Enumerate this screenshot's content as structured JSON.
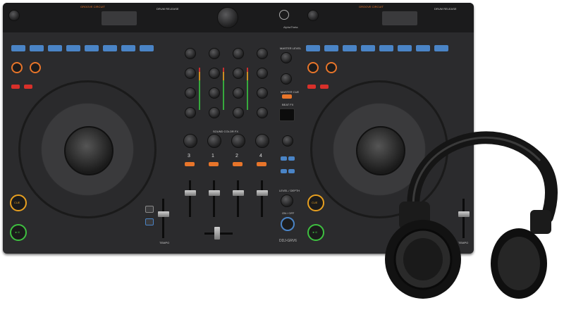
{
  "product": {
    "model": "DDJ-GRV6",
    "brand": "AlphaTheta"
  },
  "deck_labels": {
    "groove_circuit": "GROOVE CIRCUIT",
    "capture": "CAPTURE",
    "drum_release": "DRUM RELEASE",
    "beat_fx": "BEAT FX",
    "sound_color_fx": "SOUND COLOR FX",
    "master_level": "MASTER LEVEL",
    "master_cue": "MASTER CUE",
    "level_depth": "LEVEL / DEPTH",
    "on_off": "ON / OFF",
    "cue": "CUE",
    "play": "►/II",
    "tempo": "TEMPO"
  },
  "channels": [
    "3",
    "1",
    "2",
    "4"
  ],
  "eq_labels": [
    "TRIM",
    "HI",
    "MID",
    "LOW"
  ],
  "colors": {
    "body": "#2b2b2d",
    "pad_blue": "#4a84c6",
    "accent_orange": "#e8752a",
    "accent_red": "#d8302a"
  }
}
